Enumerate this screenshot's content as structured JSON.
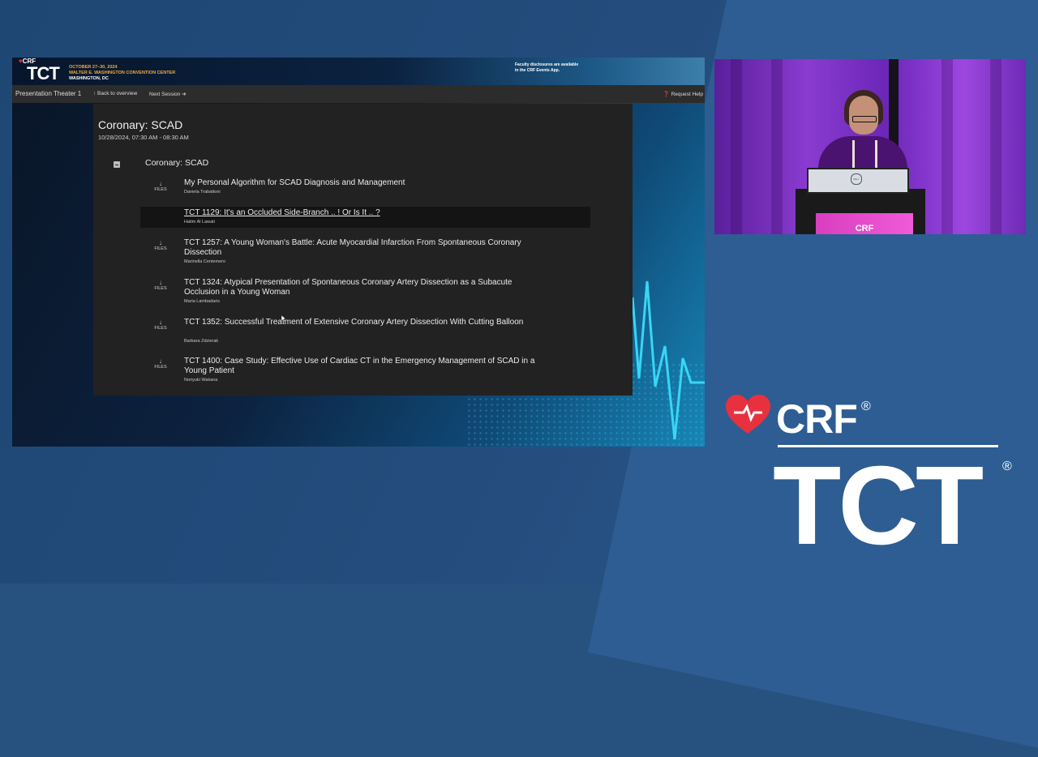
{
  "header": {
    "crf": "CRF",
    "tct": "TCT",
    "dates": "OCTOBER 27–30, 2024",
    "venue": "WALTER E. WASHINGTON CONVENTION CENTER",
    "city": "WASHINGTON, DC",
    "disclosure_line1": "Faculty disclosures are available",
    "disclosure_line2": "in the CRF Events App."
  },
  "nav": {
    "theater": "Presentation Theater 1",
    "back": "↑ Back to overview",
    "next": "Next Session ➔",
    "help": "❓ Request Help"
  },
  "session": {
    "title": "Coronary: SCAD",
    "datetime": "10/28/2024, 07:30 AM - 08:30 AM",
    "section_title": "Coronary: SCAD"
  },
  "files_label": "FILES",
  "talks": [
    {
      "title": "My Personal Algorithm for SCAD Diagnosis and Management",
      "speaker": "Daniela Trabattoni",
      "has_files": true
    },
    {
      "title": "TCT 1129: It's an Occluded Side-Branch .. ! Or Is It .. ?",
      "speaker": "Hatim Al Lawati",
      "has_files": false
    },
    {
      "title": "TCT 1257: A Young Woman's Battle: Acute Myocardial Infarction From Spontaneous Coronary Dissection",
      "speaker": "Marinella Centemero",
      "has_files": true
    },
    {
      "title": "TCT 1324: Atypical Presentation of Spontaneous Coronary Artery Dissection as a Subacute Occlusion in a Young Woman",
      "speaker": "Maria Lambadaris",
      "has_files": true
    },
    {
      "title": "TCT 1352: Successful Treatment of Extensive Coronary Artery Dissection With Cutting Balloon",
      "speaker": "Barbara Zdzierak",
      "has_files": true
    },
    {
      "title": "TCT 1400: Case Study: Effective Use of Cardiac CT in the Emergency Management of SCAD in a Young Patient",
      "speaker": "Noriyuki Wakana",
      "has_files": true
    }
  ],
  "camera": {
    "podium_text": "CRF"
  },
  "brand": {
    "crf": "CRF",
    "tct": "TCT",
    "registered": "®"
  },
  "colors": {
    "background": "#27517f",
    "accent_red": "#e8313e",
    "accent_orange": "#f2a93b",
    "ekg_cyan": "#38d6f5"
  }
}
